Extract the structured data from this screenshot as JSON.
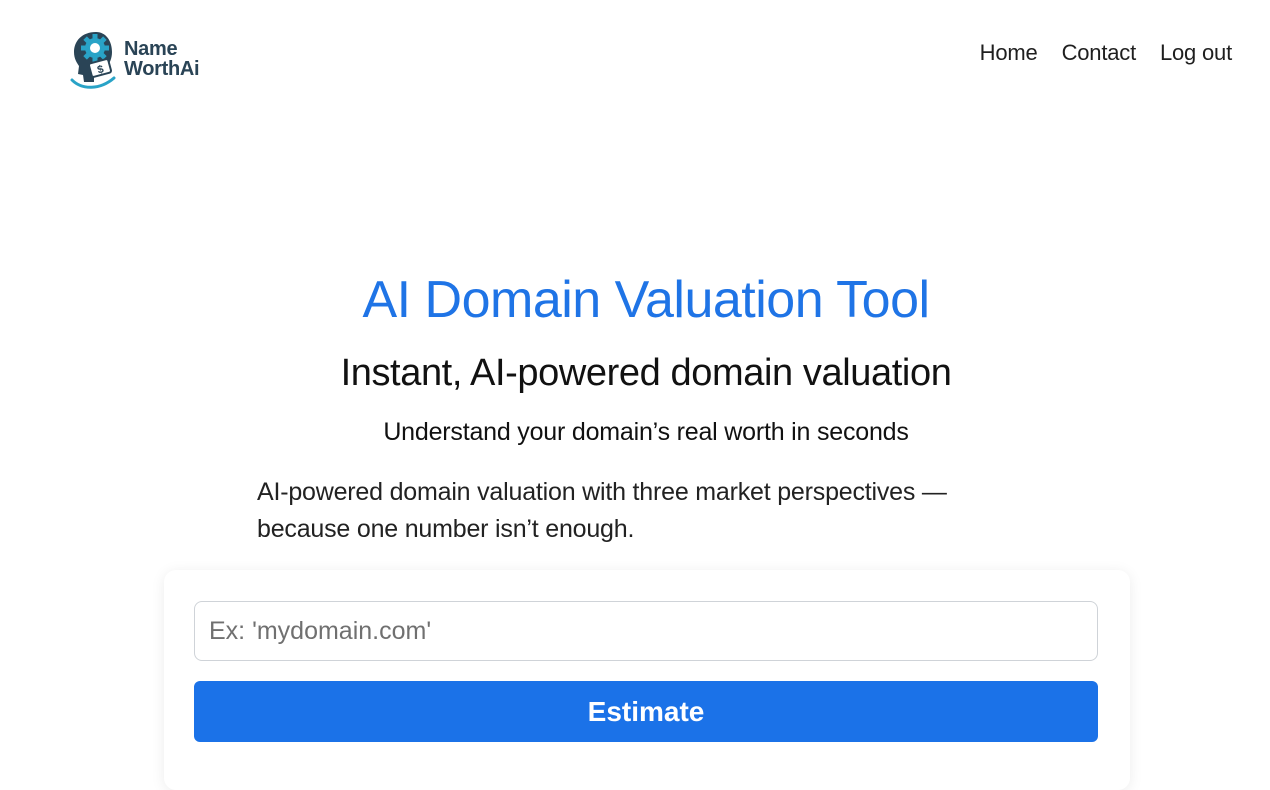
{
  "brand": {
    "line1": "Name",
    "line2": "WorthAi",
    "accent_color": "#1f74e6",
    "logo_color": "#2a4456"
  },
  "nav": {
    "items": [
      {
        "label": "Home"
      },
      {
        "label": "Contact"
      },
      {
        "label": "Log out"
      }
    ]
  },
  "hero": {
    "title": "AI Domain Valuation Tool",
    "subtitle": "Instant, AI-powered domain valuation",
    "tagline": "Understand your domain’s real worth in seconds",
    "description": "AI-powered domain valuation with three market perspectives — because one number isn’t enough."
  },
  "form": {
    "domain_placeholder": "Ex: 'mydomain.com'",
    "domain_value": "",
    "submit_label": "Estimate",
    "button_color": "#1b72e8"
  }
}
